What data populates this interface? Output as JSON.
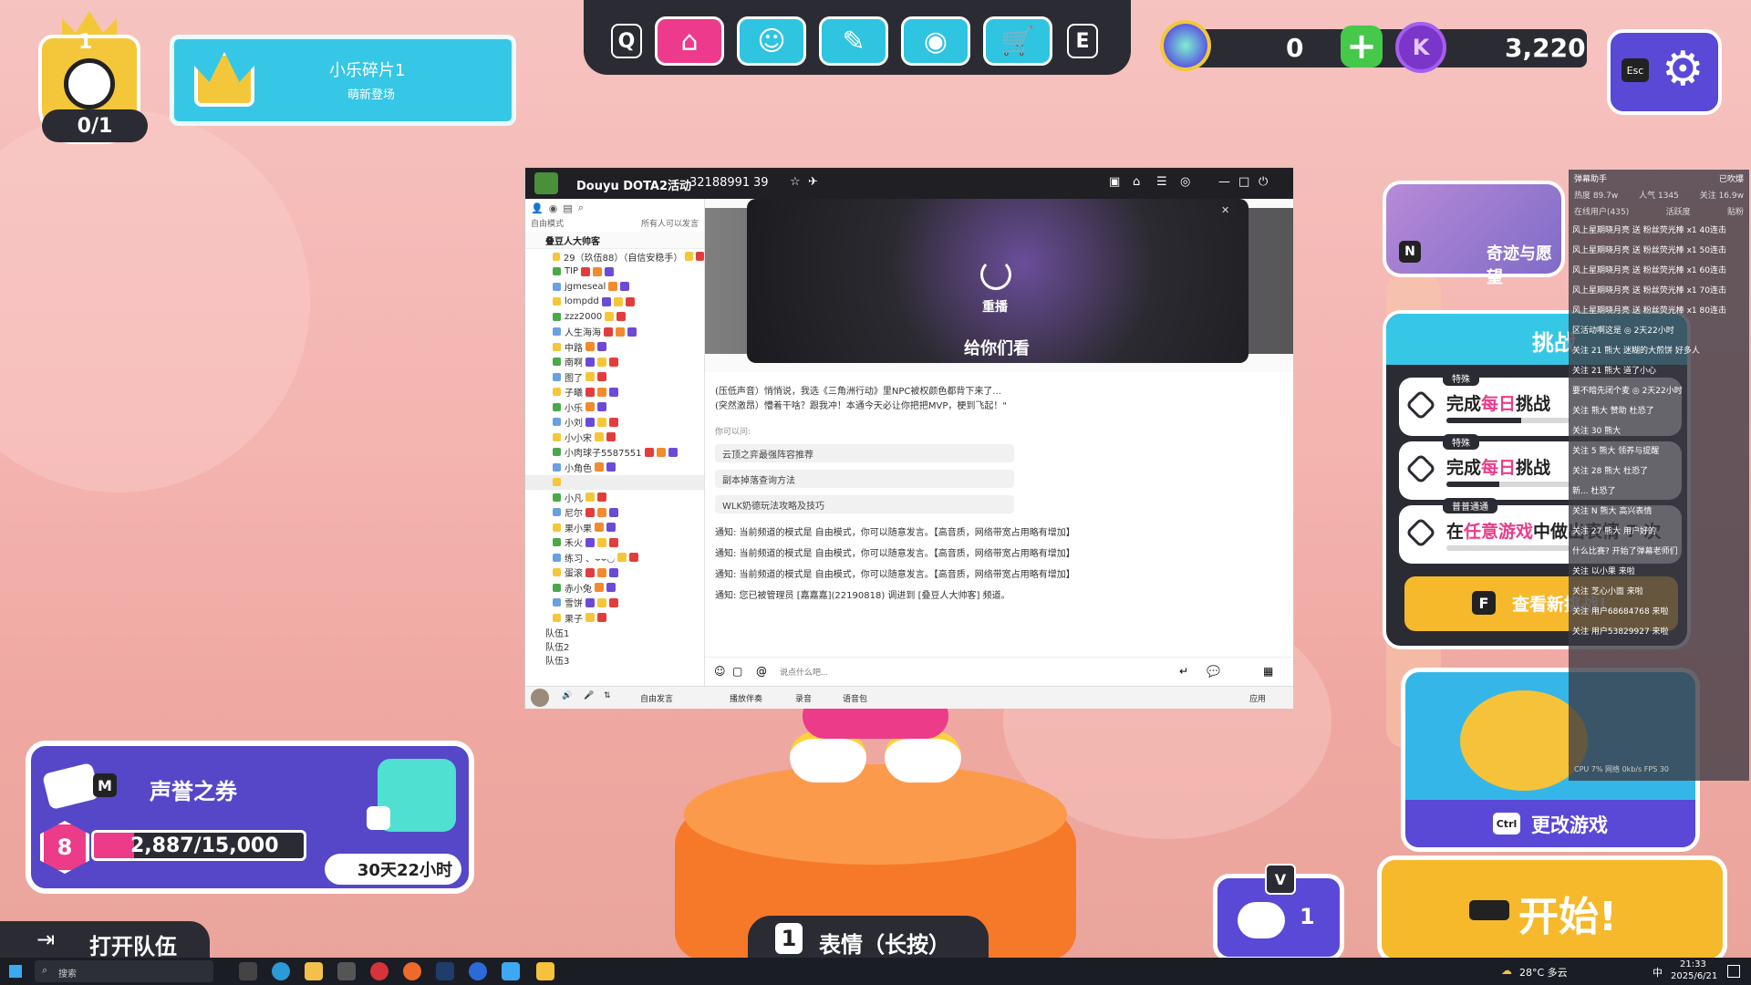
{
  "nav": {
    "left_key": "Q",
    "right_key": "E",
    "icons": [
      "home-icon",
      "character-icon",
      "wrench-icon",
      "camera-icon",
      "cart-icon"
    ]
  },
  "currency": {
    "gems": "0",
    "coins": "3,220",
    "add_symbol": "+"
  },
  "settings": {
    "esc_key": "Esc"
  },
  "crown": {
    "level": "1",
    "progress": "0/1"
  },
  "banner": {
    "title": "小乐碎片1",
    "subtitle": "萌新登场"
  },
  "reputation": {
    "key": "M",
    "title": "声誉之券",
    "tier": "8",
    "points": "2,887/15,000",
    "progress_fraction": 0.19,
    "timer": "30天22小时"
  },
  "bottom": {
    "team_label": "打开队伍",
    "emote_key": "1",
    "emote_label": "表情（长按）"
  },
  "party": {
    "key": "V",
    "count": "1"
  },
  "right": {
    "event_key": "N",
    "event_title": "奇迹与愿望",
    "challenges_title": "挑战",
    "challenges": [
      {
        "tag": "特殊",
        "prefix": "完成",
        "highlight": "每日",
        "suffix": "挑战",
        "progress": 0.6
      },
      {
        "tag": "特殊",
        "prefix": "完成",
        "highlight": "每日",
        "suffix": "挑战",
        "progress": 0.43
      },
      {
        "tag": "普普通通",
        "prefix": "在",
        "highlight": "任意游戏",
        "suffix": "中做出表情 7 次",
        "progress": 0.0
      }
    ],
    "view_key": "F",
    "view_label": "查看新挑战!",
    "change_key": "Ctrl",
    "change_label": "更改游戏",
    "start_label": "开始!"
  },
  "window": {
    "title": "Douyu DOTA2活动",
    "room_id": "32188991",
    "online": "39",
    "free_mode": "自由模式",
    "free_mode_note": "所有人可以发言",
    "channel": "叠豆人大帅客",
    "users": [
      "29（玖伍88）（自信安稳手）",
      "TIP",
      "jgmeseal",
      "lompdd",
      "zzz2000",
      "人生海海",
      "中路",
      "南啊",
      "图了",
      "子曦",
      "小乐",
      "小刘",
      "小小宋",
      "小肉球子5587551",
      "小角色",
      "",
      "小凡",
      "尼尔",
      "果小果",
      "禾火",
      "练习 、⌣⌣◡",
      "蛋滚",
      "赤小兔",
      "雪饼",
      "果子"
    ],
    "groups": [
      "队伍1",
      "队伍2",
      "队伍3"
    ],
    "video_overlay": "给你们看",
    "replay": "重播",
    "chat_lines": [
      "(压低声音）悄悄说，我选《三角洲行动》里NPC被权颜色都背下来了...",
      "(突然激昂）懵着干啥？跟我冲！本通今天必让你把把MVP，梗到飞起！\""
    ],
    "suggest_head": "你可以问:",
    "suggestions": [
      "云顶之弈最强阵容推荐",
      "副本掉落查询方法",
      "WLK奶德玩法攻略及技巧"
    ],
    "notices": [
      "通知: 当前频道的模式是 自由模式，你可以随意发言。【高音质，网络带宽占用略有增加】",
      "通知: 当前频道的模式是 自由模式，你可以随意发言。【高音质，网络带宽占用略有增加】",
      "通知: 当前频道的模式是 自由模式，你可以随意发言。【高音质，网络带宽占用略有增加】",
      "通知: 您已被管理员 [嘉嘉嘉](22190818) 调进到 [叠豆人大帅客] 频道。"
    ],
    "input_placeholder": "说点什么吧...",
    "bottom_tools": [
      "自由发言",
      "播放伴奏",
      "录音",
      "语音包"
    ],
    "bottom_right": "应用"
  },
  "danmu": {
    "header": "弹幕助手",
    "header_right": "已吹爆",
    "stats": [
      "热度 89.7w",
      "人气 1345",
      "关注 16.9w"
    ],
    "tabs": [
      "在线用户(435)",
      "活跃度",
      "贴粉"
    ],
    "rows": [
      "风上星期晓月亮 送 粉丝荧光棒 x1 40连击",
      "风上星期晓月亮 送 粉丝荧光棒 x1 50连击",
      "风上星期晓月亮 送 粉丝荧光棒 x1 60连击",
      "风上星期晓月亮 送 粉丝荧光棒 x1 70连击",
      "风上星期晓月亮 送 粉丝荧光棒 x1 80连击",
      "区活动啊这是 ◎ 2天22小时",
      "关注 21 熊大 迷糊的大煎饼 好多人",
      "关注 21 熊大 道了小心",
      "要不暗先闭个麦 ◎ 2天22小时",
      "关注 熊大 赞助 杜恐了",
      "关注 30 熊大",
      "关注 5 熊大 领养与提醒",
      "关注 28 熊大 杜恐了",
      "新... 杜恐了",
      "关注 N 熊大 高兴表情",
      "关注 27 熊大 用户好的",
      "什么比赛? 开始了弹幕老师们",
      "关注 以小果 来啦",
      "关注 芝心小面 来啦",
      "关注 用户68684768 来啦",
      "关注 用户53829927 来啦"
    ],
    "footer": "CPU 7%   网络 0kb/s  FPS 30"
  },
  "taskbar": {
    "search_placeholder": "搜索",
    "weather": "28°C 多云",
    "ime": "中",
    "time": "21:33",
    "date": "2025/6/21"
  }
}
